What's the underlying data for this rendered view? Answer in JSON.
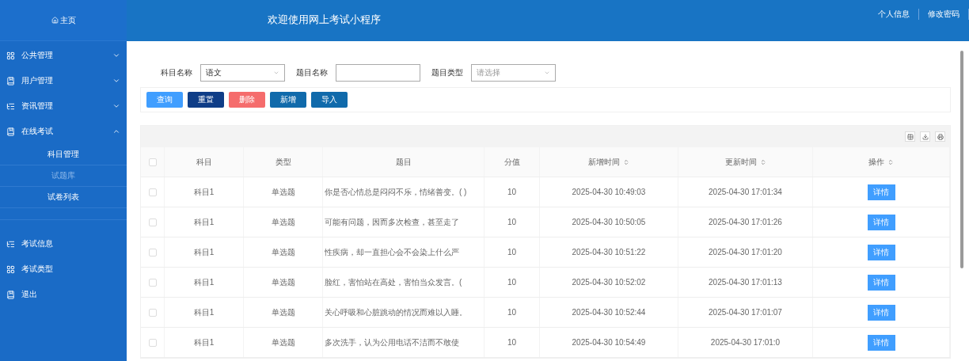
{
  "sidebar": {
    "home": "主页",
    "items": [
      {
        "label": "公共管理",
        "kind": "grid",
        "expanded": false
      },
      {
        "label": "用户管理",
        "kind": "book",
        "expanded": false
      },
      {
        "label": "资讯管理",
        "kind": "list",
        "expanded": false
      },
      {
        "label": "在线考试",
        "kind": "book",
        "expanded": true,
        "children": [
          {
            "label": "科目管理",
            "selected": false
          },
          {
            "label": "试题库",
            "selected": true
          },
          {
            "label": "试卷列表",
            "selected": false
          }
        ]
      },
      {
        "label": "考试信息",
        "kind": "list"
      },
      {
        "label": "考试类型",
        "kind": "grid"
      },
      {
        "label": "退出",
        "kind": "book"
      }
    ]
  },
  "header": {
    "title": "欢迎使用网上考试小程序",
    "links": [
      "个人信息",
      "修改密码"
    ]
  },
  "search": {
    "fields": [
      {
        "label": "科目名称",
        "kind": "select",
        "value": "语文"
      },
      {
        "label": "题目名称",
        "kind": "text"
      },
      {
        "label": "题目类型",
        "kind": "select",
        "placeholder": "请选择"
      }
    ],
    "buttons": [
      {
        "label": "查询",
        "color": "#409eff"
      },
      {
        "label": "重置",
        "color": "#0f3d87"
      },
      {
        "label": "删除",
        "color": "#f56c6c"
      },
      {
        "label": "新增",
        "color": "#106aab"
      },
      {
        "label": "导入",
        "color": "#106aab"
      }
    ]
  },
  "table": {
    "all_checked": false,
    "columns": [
      {
        "label": "科目",
        "sortable": false
      },
      {
        "label": "类型",
        "sortable": false
      },
      {
        "label": "题目",
        "sortable": false
      },
      {
        "label": "分值",
        "sortable": false
      },
      {
        "label": "新增时间",
        "sortable": true
      },
      {
        "label": "更新时间",
        "sortable": true
      },
      {
        "label": "操作",
        "sortable": true
      }
    ],
    "rows": [
      {
        "checked": false,
        "cells": [
          "科目1",
          "单选题",
          "你是否心情总是闷闷不乐，情绪善变。( )",
          "10",
          "2025-04-30 10:49:03",
          "2025-04-30 17:01:34"
        ],
        "action": "详情"
      },
      {
        "checked": false,
        "cells": [
          "科目1",
          "单选题",
          "可能有问题，因而多次检查，甚至走了",
          "10",
          "2025-04-30 10:50:05",
          "2025-04-30 17:01:26"
        ],
        "action": "详情"
      },
      {
        "checked": false,
        "cells": [
          "科目1",
          "单选题",
          "性疾病，却一直担心会不会染上什么严",
          "10",
          "2025-04-30 10:51:22",
          "2025-04-30 17:01:20"
        ],
        "action": "详情"
      },
      {
        "checked": false,
        "cells": [
          "科目1",
          "单选题",
          "脸红，害怕站在高处，害怕当众发言。(",
          "10",
          "2025-04-30 10:52:02",
          "2025-04-30 17:01:13"
        ],
        "action": "详情"
      },
      {
        "checked": false,
        "cells": [
          "科目1",
          "单选题",
          "关心呼吸和心脏跳动的情况而难以入睡。",
          "10",
          "2025-04-30 10:52:44",
          "2025-04-30 17:01:07"
        ],
        "action": "详情"
      },
      {
        "checked": false,
        "cells": [
          "科目1",
          "单选题",
          "多次洗手，认为公用电话不洁而不敢使",
          "10",
          "2025-04-30 10:54:49",
          "2025-04-30 17:01:0"
        ],
        "action": "详情"
      }
    ]
  }
}
